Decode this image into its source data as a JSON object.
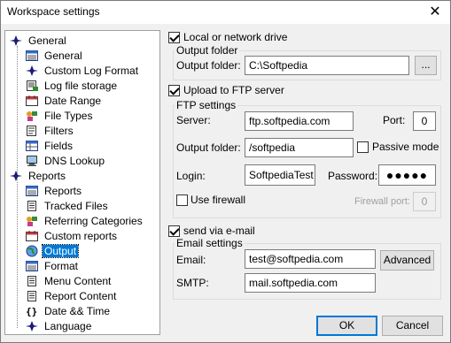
{
  "window": {
    "title": "Workspace settings"
  },
  "tree": {
    "items": [
      {
        "label": "General",
        "icon": "diamond-icon",
        "level": 0
      },
      {
        "label": "General",
        "icon": "grid-page-icon",
        "level": 1
      },
      {
        "label": "Custom Log Format",
        "icon": "diamond-icon",
        "level": 1
      },
      {
        "label": "Log file storage",
        "icon": "log-storage-icon",
        "level": 1
      },
      {
        "label": "Date Range",
        "icon": "calendar-icon",
        "level": 1
      },
      {
        "label": "File Types",
        "icon": "file-types-icon",
        "level": 1
      },
      {
        "label": "Filters",
        "icon": "filter-icon",
        "level": 1
      },
      {
        "label": "Fields",
        "icon": "fields-icon",
        "level": 1
      },
      {
        "label": "DNS Lookup",
        "icon": "computer-icon",
        "level": 1
      },
      {
        "label": "Reports",
        "icon": "diamond-icon",
        "level": 0
      },
      {
        "label": "Reports",
        "icon": "grid-page-icon",
        "level": 1
      },
      {
        "label": "Tracked Files",
        "icon": "document-icon",
        "level": 1
      },
      {
        "label": "Referring Categories",
        "icon": "file-types-icon",
        "level": 1
      },
      {
        "label": "Custom reports",
        "icon": "calendar-icon",
        "level": 1
      },
      {
        "label": "Output",
        "icon": "globe-icon",
        "level": 1,
        "selected": true
      },
      {
        "label": "Format",
        "icon": "grid-page-icon",
        "level": 1
      },
      {
        "label": "Menu Content",
        "icon": "document-icon",
        "level": 1
      },
      {
        "label": "Report Content",
        "icon": "document-icon",
        "level": 1
      },
      {
        "label": "Date && Time",
        "icon": "braces-icon",
        "level": 1
      },
      {
        "label": "Language",
        "icon": "diamond-icon",
        "level": 1
      }
    ]
  },
  "local": {
    "checkbox_label": "Local or network drive",
    "checked": true,
    "group_title": "Output folder",
    "folder_label": "Output folder:",
    "folder_value": "C:\\Softpedia",
    "browse_label": "..."
  },
  "ftp": {
    "checkbox_label": "Upload to FTP server",
    "checked": true,
    "group_title": "FTP settings",
    "server_label": "Server:",
    "server_value": "ftp.softpedia.com",
    "port_label": "Port:",
    "port_value": "0",
    "folder_label": "Output folder:",
    "folder_value": "/softpedia",
    "passive_label": "Passive mode",
    "passive_checked": false,
    "login_label": "Login:",
    "login_value": "SoftpediaTest",
    "password_label": "Password:",
    "password_value": "●●●●●",
    "firewall_label": "Use firewall",
    "firewall_checked": false,
    "firewall_port_label": "Firewall port:",
    "firewall_port_value": "0"
  },
  "email": {
    "checkbox_label": "send via e-mail",
    "checked": true,
    "group_title": "Email settings",
    "email_label": "Email:",
    "email_value": "test@softpedia.com",
    "advanced_label": "Advanced",
    "smtp_label": "SMTP:",
    "smtp_value": "mail.softpedia.com"
  },
  "footer": {
    "ok_label": "OK",
    "cancel_label": "Cancel"
  },
  "colors": {
    "selection": "#0078d7",
    "diamond": "#1a1a7a"
  }
}
